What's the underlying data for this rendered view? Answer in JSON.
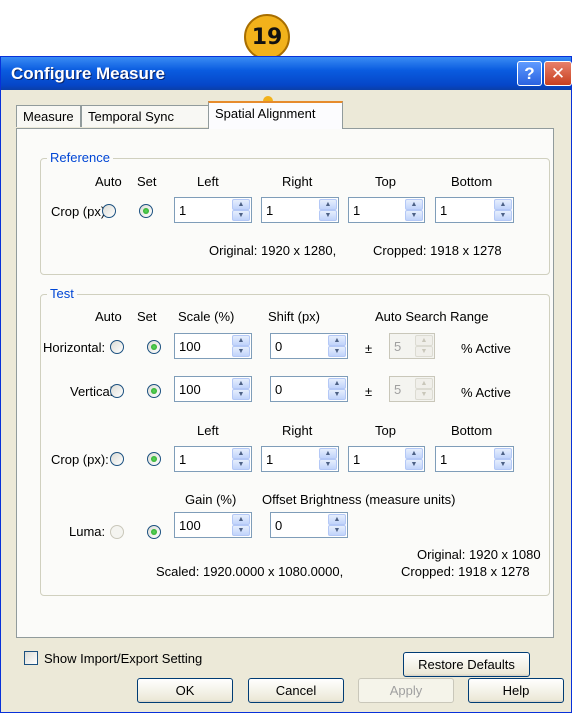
{
  "callout": "19",
  "window": {
    "title": "Configure Measure",
    "help_glyph": "?",
    "close_glyph": "✕"
  },
  "tabs": [
    "Measure",
    "Temporal Sync",
    "Spatial Alignment"
  ],
  "reference": {
    "group_label": "Reference",
    "auto_label": "Auto",
    "set_label": "Set",
    "crop_label": "Crop (px):",
    "left_label": "Left",
    "right_label": "Right",
    "top_label": "Top",
    "bottom_label": "Bottom",
    "left_value": "1",
    "right_value": "1",
    "top_value": "1",
    "bottom_value": "1",
    "original": "Original: 1920 x 1280,",
    "cropped": "Cropped: 1918 x 1278"
  },
  "test": {
    "group_label": "Test",
    "auto_label": "Auto",
    "set_label": "Set",
    "scale_label": "Scale (%)",
    "shift_label": "Shift (px)",
    "search_label": "Auto Search Range",
    "horizontal_label": "Horizontal:",
    "vertical_label": "Vertical:",
    "h_scale": "100",
    "h_shift": "0",
    "h_range": "5",
    "v_scale": "100",
    "v_shift": "0",
    "v_range": "5",
    "plusminus": "±",
    "active_label": "% Active",
    "left_label": "Left",
    "right_label": "Right",
    "top_label": "Top",
    "bottom_label": "Bottom",
    "crop_label": "Crop (px):",
    "crop_left": "1",
    "crop_right": "1",
    "crop_top": "1",
    "crop_bottom": "1",
    "gain_label": "Gain (%)",
    "offset_label": "Offset Brightness (measure units)",
    "luma_label": "Luma:",
    "gain_value": "100",
    "offset_value": "0",
    "original": "Original: 1920 x 1080",
    "scaled": "Scaled: 1920.0000 x 1080.0000,",
    "cropped": "Cropped: 1918 x 1278"
  },
  "restore_defaults": "Restore Defaults",
  "show_import_export": "Show Import/Export Setting",
  "footer_buttons": {
    "ok": "OK",
    "cancel": "Cancel",
    "apply": "Apply",
    "help": "Help"
  },
  "colors": {
    "titlebar": "#0a5ce0",
    "dialog_bg": "#ece9d8",
    "group_label": "#0046d5",
    "active_tab_accent": "#e68b2c",
    "callout": "#f2b21b"
  }
}
